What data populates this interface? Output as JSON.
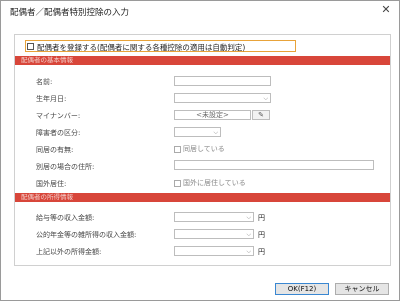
{
  "window": {
    "title": "配偶者／配偶者特別控除の入力",
    "close_glyph": "✕"
  },
  "spouse_checkbox": {
    "label": "配偶者を登録する(配偶者に関する各種控除の適用は自動判定)"
  },
  "sections": {
    "basic": "配偶者の基本情報",
    "income": "配偶者の所得情報"
  },
  "fields": {
    "name": {
      "label": "名前:",
      "value": ""
    },
    "birthdate": {
      "label": "生年月日:",
      "value": ""
    },
    "my_number": {
      "label": "マイナンバー:",
      "value": "<未設定>"
    },
    "disability": {
      "label": "障害者の区分:",
      "value": ""
    },
    "cohabitation": {
      "label": "同居の有無:",
      "checkbox_text": "同居している",
      "checked": true
    },
    "separate_address": {
      "label": "別居の場合の住所:",
      "value": ""
    },
    "residence_abroad": {
      "label": "国外居住:",
      "checkbox_text": "国外に居住している",
      "checked": false
    }
  },
  "income": {
    "salary": {
      "label": "給与等の収入金額:",
      "value": "",
      "unit": "円"
    },
    "pension": {
      "label": "公的年金等の雑所得の収入金額:",
      "value": "",
      "unit": "円"
    },
    "other": {
      "label": "上記以外の所得金額:",
      "value": "",
      "unit": "円"
    }
  },
  "buttons": {
    "ok": "OK(F12)",
    "cancel": "キャンセル"
  },
  "colors": {
    "section_header": "#d8463a",
    "checkbox_border": "#e8a33a",
    "primary_border": "#3a87d1"
  },
  "icons": {
    "edit": "pencil-icon",
    "dropdown": "chevron-down-icon",
    "close": "close-icon"
  }
}
